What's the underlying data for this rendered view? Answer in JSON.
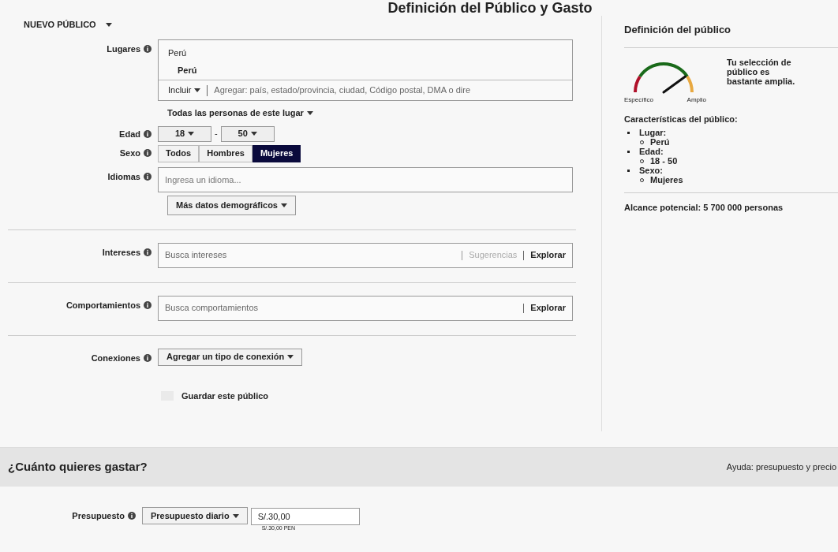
{
  "slide_title": "Definición del Público y Gasto",
  "audience_menu": "NUEVO PÚBLICO",
  "places": {
    "label": "Lugares",
    "group": "Perú",
    "item": "Perú",
    "mode": "Incluir",
    "placeholder": "Agregar: país, estado/provincia, ciudad, Código postal, DMA o dire",
    "scope": "Todas las personas de este lugar"
  },
  "age": {
    "label": "Edad",
    "from": "18",
    "separator": "-",
    "to": "50"
  },
  "gender": {
    "label": "Sexo",
    "options": [
      {
        "label": "Todos",
        "selected": false
      },
      {
        "label": "Hombres",
        "selected": false
      },
      {
        "label": "Mujeres",
        "selected": true
      }
    ]
  },
  "languages": {
    "label": "Idiomas",
    "placeholder": "Ingresa un idioma..."
  },
  "more_demographics": "Más datos demográficos",
  "interests": {
    "label": "Intereses",
    "placeholder": "Busca intereses",
    "suggestions": "Sugerencias",
    "explore": "Explorar"
  },
  "behaviors": {
    "label": "Comportamientos",
    "placeholder": "Busca comportamientos",
    "explore": "Explorar"
  },
  "connections": {
    "label": "Conexiones",
    "button": "Agregar un tipo de conexión"
  },
  "save_audience": {
    "label": "Guardar este público",
    "checked": false
  },
  "sidebar": {
    "title": "Definición del público",
    "gauge": {
      "low": "Específico",
      "high": "Amplio"
    },
    "verdict": "Tu selección de público es bastante amplia.",
    "characteristics_title": "Características del público:",
    "characteristics": [
      {
        "label": "Lugar:",
        "children": [
          {
            "label": "Perú"
          }
        ]
      },
      {
        "label": "Edad:",
        "children": [
          {
            "label": "18 - 50"
          }
        ]
      },
      {
        "label": "Sexo:",
        "children": [
          {
            "label": "Mujeres"
          }
        ]
      }
    ],
    "reach": "Alcance potencial: 5 700 000 personas"
  },
  "budget_section": {
    "title": "¿Cuánto quieres gastar?",
    "help": "Ayuda: presupuesto y precio",
    "label": "Presupuesto",
    "type": "Presupuesto diario",
    "value": "S/.30,00",
    "note": "S/.30,00 PEN"
  }
}
